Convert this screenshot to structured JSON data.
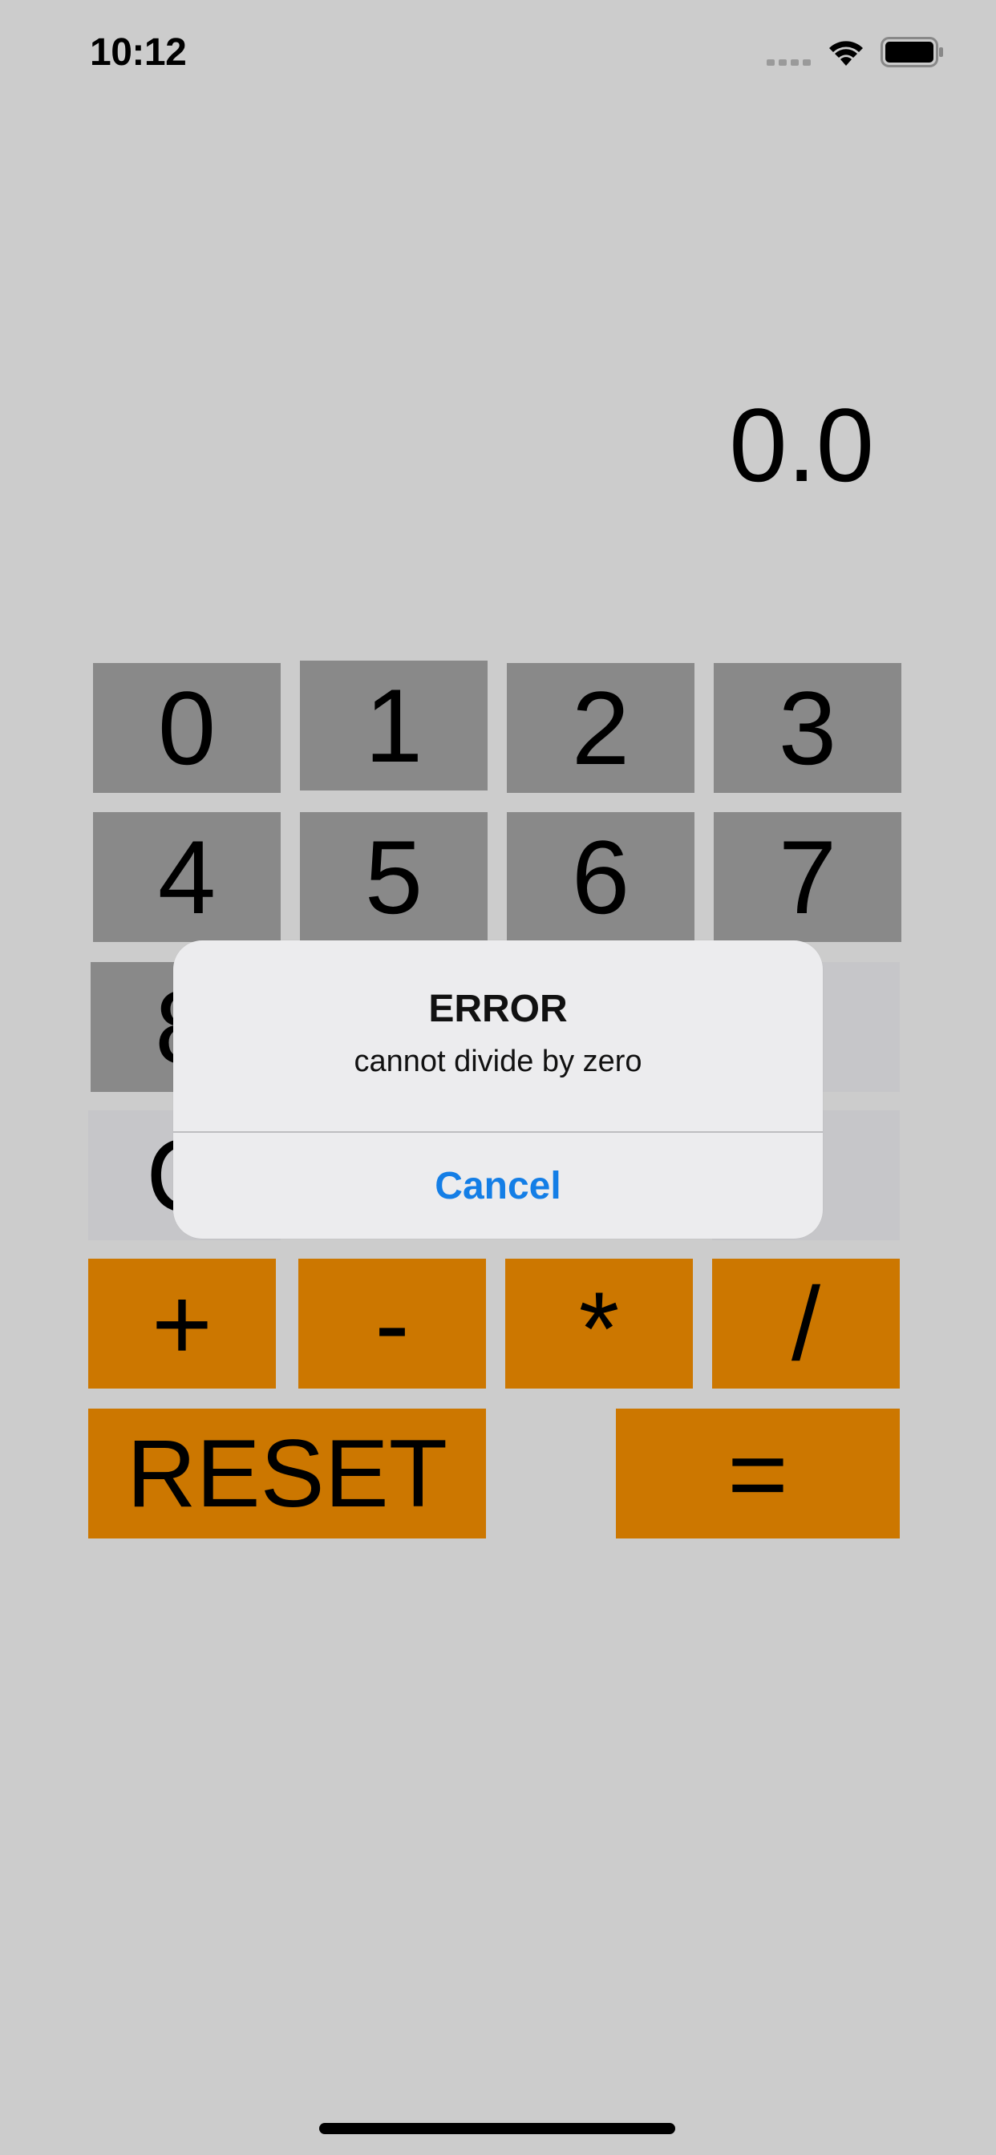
{
  "status_bar": {
    "time": "10:12"
  },
  "display": {
    "value": "0.0"
  },
  "keypad": {
    "row1": [
      "0",
      "1",
      "2",
      "3"
    ],
    "row2": [
      "4",
      "5",
      "6",
      "7"
    ],
    "row3": [
      "8",
      "",
      "",
      "8"
    ],
    "row4": [
      "C",
      "",
      "",
      "F"
    ],
    "operators": [
      "+",
      "-",
      "*",
      "/"
    ],
    "reset": "RESET",
    "equals": "="
  },
  "alert": {
    "title": "ERROR",
    "message": "cannot divide by zero",
    "cancel_label": "Cancel"
  },
  "colors": {
    "background": "#cccccc",
    "digit_key": "#898989",
    "disabled_key": "#c6c6c9",
    "operator_key": "#cc7700",
    "alert_action": "#147ee6"
  }
}
